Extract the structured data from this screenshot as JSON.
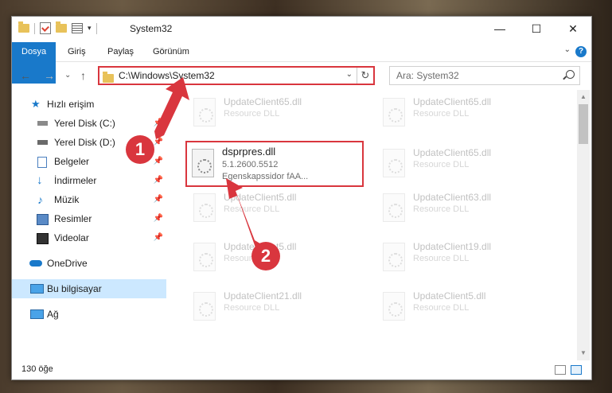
{
  "window": {
    "title": "System32",
    "minimize_icon": "minimize-icon",
    "maximize_icon": "maximize-icon",
    "close_icon": "close-icon"
  },
  "ribbon": {
    "tabs": [
      "Dosya",
      "Giriş",
      "Paylaş",
      "Görünüm"
    ],
    "help": "?"
  },
  "address": {
    "path": "C:\\Windows\\System32"
  },
  "search": {
    "placeholder": "Ara: System32"
  },
  "sidebar": {
    "items": [
      {
        "label": "Hızlı erişim",
        "icon": "star-icon"
      },
      {
        "label": "Yerel Disk (C:)",
        "icon": "drive-icon"
      },
      {
        "label": "Yerel Disk (D:)",
        "icon": "drive-icon"
      },
      {
        "label": "Belgeler",
        "icon": "documents-icon"
      },
      {
        "label": "İndirmeler",
        "icon": "download-icon"
      },
      {
        "label": "Müzik",
        "icon": "music-icon"
      },
      {
        "label": "Resimler",
        "icon": "pictures-icon"
      },
      {
        "label": "Videolar",
        "icon": "videos-icon"
      },
      {
        "label": "OneDrive",
        "icon": "cloud-icon"
      },
      {
        "label": "Bu bilgisayar",
        "icon": "computer-icon"
      },
      {
        "label": "Ağ",
        "icon": "network-icon"
      }
    ]
  },
  "files": [
    {
      "name": "UpdateClient65.dll",
      "type": "Resource DLL"
    },
    {
      "name": "UpdateClient65.dll",
      "type": "Resource DLL"
    },
    {
      "name": "dsprpres.dll",
      "version": "5.1.2600.5512",
      "desc": "Egenskapssidor fAA..."
    },
    {
      "name": "UpdateClient65.dll",
      "type": "Resource DLL"
    },
    {
      "name": "UpdateClient5.dll",
      "type": "Resource DLL"
    },
    {
      "name": "UpdateClient63.dll",
      "type": "Resource DLL"
    },
    {
      "name": "UpdateClient5.dll",
      "type": "Resource DLL"
    },
    {
      "name": "UpdateClient19.dll",
      "type": "Resource DLL"
    },
    {
      "name": "UpdateClient21.dll",
      "type": "Resource DLL"
    },
    {
      "name": "UpdateClient5.dll",
      "type": "Resource DLL"
    }
  ],
  "status": {
    "count": "130 öğe"
  },
  "callouts": [
    "1",
    "2"
  ],
  "colors": {
    "accent": "#1979ca",
    "highlight": "#d9363e",
    "selected": "#cce8ff"
  }
}
